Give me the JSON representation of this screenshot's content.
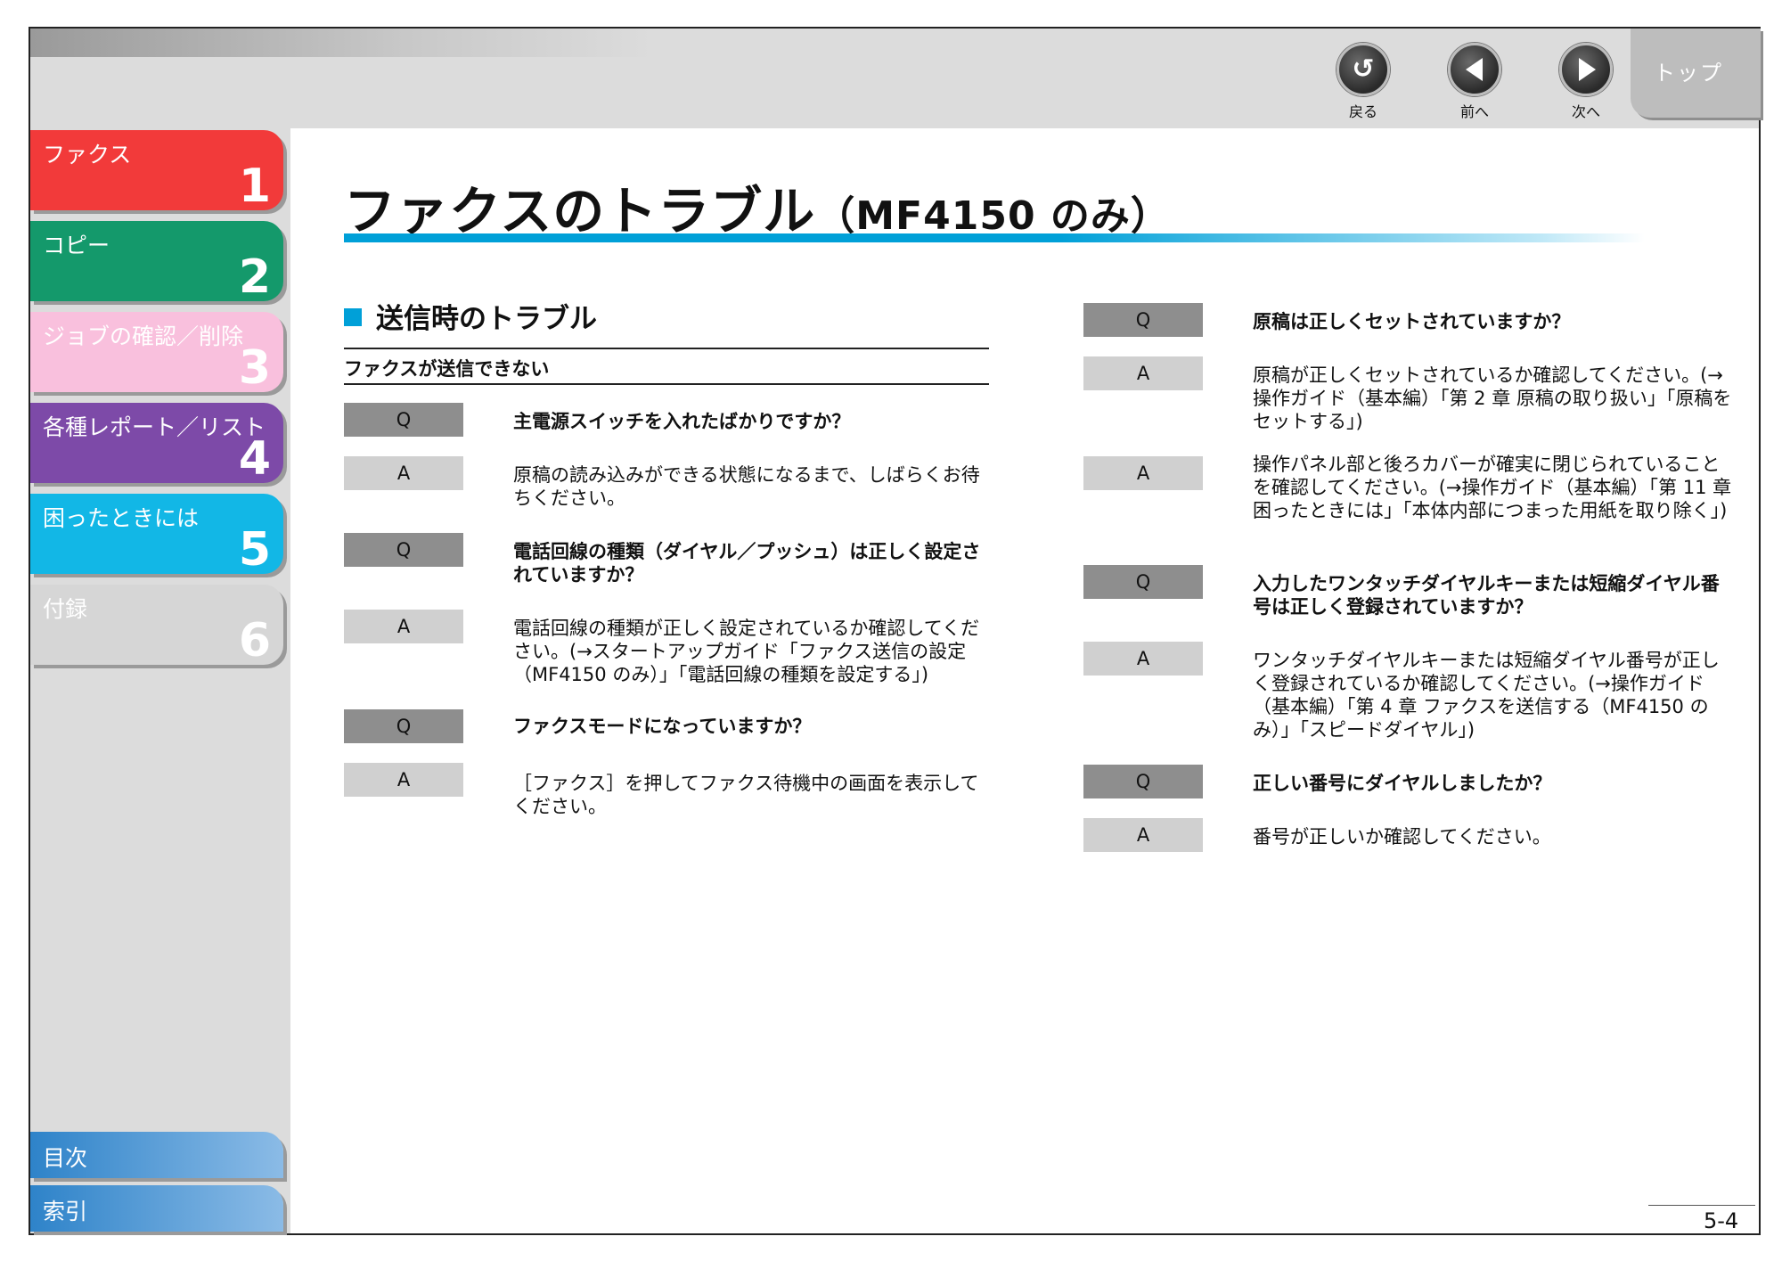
{
  "nav": {
    "back_label": "戻る",
    "prev_label": "前へ",
    "next_label": "次へ",
    "top_label": "トップ"
  },
  "chapters": [
    {
      "title": "ファクス",
      "num": "1",
      "color": "#f23a3a"
    },
    {
      "title": "コピー",
      "num": "2",
      "color": "#14996b"
    },
    {
      "title": "ジョブの確認／削除",
      "num": "3",
      "color": "#f9c0dd"
    },
    {
      "title": "各種レポート／リスト",
      "num": "4",
      "color": "#7d4aa8"
    },
    {
      "title": "困ったときには",
      "num": "5",
      "color": "#12b7e6"
    },
    {
      "title": "付録",
      "num": "6",
      "color": "#d6d6d6"
    }
  ],
  "bottom_nav": {
    "toc": "目次",
    "index": "索引"
  },
  "page": {
    "title_main": "ファクスのトラブル",
    "title_sub": "（MF4150 のみ）",
    "section": "送信時のトラブル",
    "subsection": "ファクスが送信できない",
    "page_number": "5-4"
  },
  "left_qa": [
    {
      "kind": "Q",
      "text": "主電源スイッチを入れたばかりですか？"
    },
    {
      "kind": "A",
      "text": "原稿の読み込みができる状態になるまで、しばらくお待ちください。"
    },
    {
      "kind": "Q",
      "text": "電話回線の種類（ダイヤル／プッシュ）は正しく設定されていますか？"
    },
    {
      "kind": "A",
      "text": "電話回線の種類が正しく設定されているか確認してください。(→スタートアップガイド「ファクス送信の設定（MF4150 のみ）」「電話回線の種類を設定する」)"
    },
    {
      "kind": "Q",
      "text": "ファクスモードになっていますか？"
    },
    {
      "kind": "A",
      "text": "［ファクス］を押してファクス待機中の画面を表示してください。"
    }
  ],
  "right_qa": [
    {
      "kind": "Q",
      "text": "原稿は正しくセットされていますか？"
    },
    {
      "kind": "A",
      "text": "原稿が正しくセットされているか確認してください。(→操作ガイド（基本編）「第 2 章 原稿の取り扱い」「原稿をセットする」)"
    },
    {
      "kind": "A",
      "text": "操作パネル部と後ろカバーが確実に閉じられていることを確認してください。(→操作ガイド（基本編）「第 11 章 困ったときには」「本体内部につまった用紙を取り除く」)"
    },
    {
      "kind": "Q",
      "text": "入力したワンタッチダイヤルキーまたは短縮ダイヤル番号は正しく登録されていますか？"
    },
    {
      "kind": "A",
      "text": "ワンタッチダイヤルキーまたは短縮ダイヤル番号が正しく登録されているか確認してください。(→操作ガイド（基本編）「第 4 章 ファクスを送信する（MF4150 のみ）」「スピードダイヤル」)"
    },
    {
      "kind": "Q",
      "text": "正しい番号にダイヤルしましたか？"
    },
    {
      "kind": "A",
      "text": "番号が正しいか確認してください。"
    }
  ]
}
